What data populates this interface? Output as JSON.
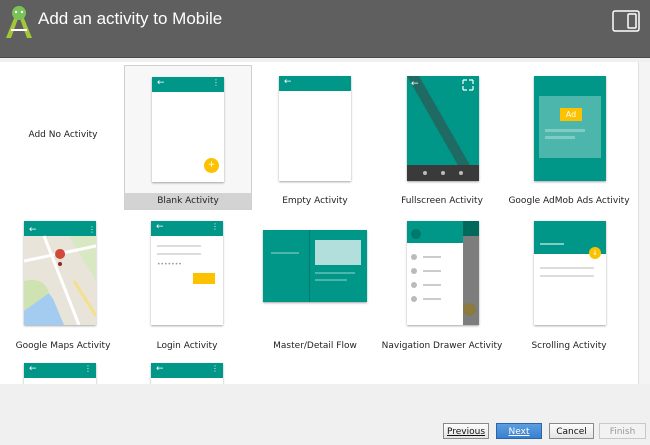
{
  "header": {
    "title": "Add an activity to Mobile"
  },
  "templates": [
    {
      "label": "Add No Activity"
    },
    {
      "label": "Blank Activity"
    },
    {
      "label": "Empty Activity"
    },
    {
      "label": "Fullscreen Activity"
    },
    {
      "label": "Google AdMob Ads Activity"
    },
    {
      "label": "Google Maps Activity"
    },
    {
      "label": "Login Activity"
    },
    {
      "label": "Master/Detail Flow"
    },
    {
      "label": "Navigation Drawer Activity"
    },
    {
      "label": "Scrolling Activity"
    }
  ],
  "admob": {
    "ad_label": "Ad"
  },
  "buttons": {
    "previous": "Previous",
    "next": "Next",
    "cancel": "Cancel",
    "finish": "Finish"
  },
  "colors": {
    "header": "#5f5f5f",
    "accent": "#009688",
    "fab": "#fcc200",
    "primary_button": "#3a7fcf"
  }
}
